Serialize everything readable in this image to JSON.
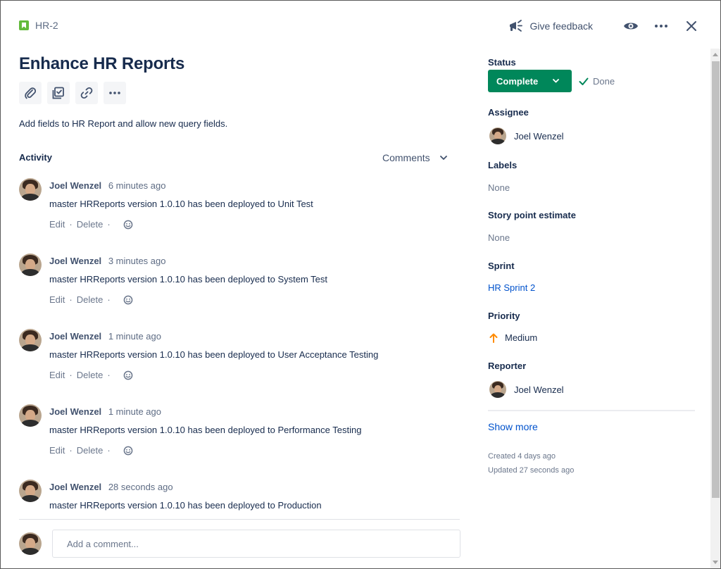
{
  "header": {
    "issue_key": "HR-2",
    "feedback_label": "Give feedback"
  },
  "issue": {
    "title": "Enhance HR Reports",
    "description": "Add fields to HR Report and allow new query fields."
  },
  "activity": {
    "label": "Activity",
    "filter": "Comments",
    "items": [
      {
        "author": "Joel Wenzel",
        "time": "6 minutes ago",
        "body": "master HRReports version 1.0.10 has been deployed to Unit Test"
      },
      {
        "author": "Joel Wenzel",
        "time": "3 minutes ago",
        "body": "master HRReports version 1.0.10 has been deployed to System Test"
      },
      {
        "author": "Joel Wenzel",
        "time": "1 minute ago",
        "body": "master HRReports version 1.0.10 has been deployed to User Acceptance Testing"
      },
      {
        "author": "Joel Wenzel",
        "time": "1 minute ago",
        "body": "master HRReports version 1.0.10 has been deployed to Performance Testing"
      },
      {
        "author": "Joel Wenzel",
        "time": "28 seconds ago",
        "body": "master HRReports version 1.0.10 has been deployed to Production"
      }
    ],
    "edit_label": "Edit",
    "delete_label": "Delete",
    "separator": "·",
    "comment_placeholder": "Add a comment..."
  },
  "sidebar": {
    "status_label": "Status",
    "status_value": "Complete",
    "resolution": "Done",
    "assignee_label": "Assignee",
    "assignee": "Joel Wenzel",
    "labels_label": "Labels",
    "labels_value": "None",
    "story_points_label": "Story point estimate",
    "story_points_value": "None",
    "sprint_label": "Sprint",
    "sprint_value": "HR Sprint 2",
    "priority_label": "Priority",
    "priority_value": "Medium",
    "reporter_label": "Reporter",
    "reporter": "Joel Wenzel",
    "show_more": "Show more",
    "created": "Created 4 days ago",
    "updated": "Updated 27 seconds ago"
  },
  "icons": {
    "issue_type": "story-icon",
    "feedback": "megaphone-icon",
    "watch": "eye-icon",
    "more": "more-icon",
    "close": "close-icon",
    "attach": "paperclip-icon",
    "child_issue": "checklist-icon",
    "link": "link-icon",
    "reaction": "smiley-icon",
    "priority": "arrow-up-icon"
  },
  "colors": {
    "status_complete": "#00875a",
    "link": "#0052cc",
    "story": "#63ba3c",
    "priority_medium": "#ff8b00"
  }
}
